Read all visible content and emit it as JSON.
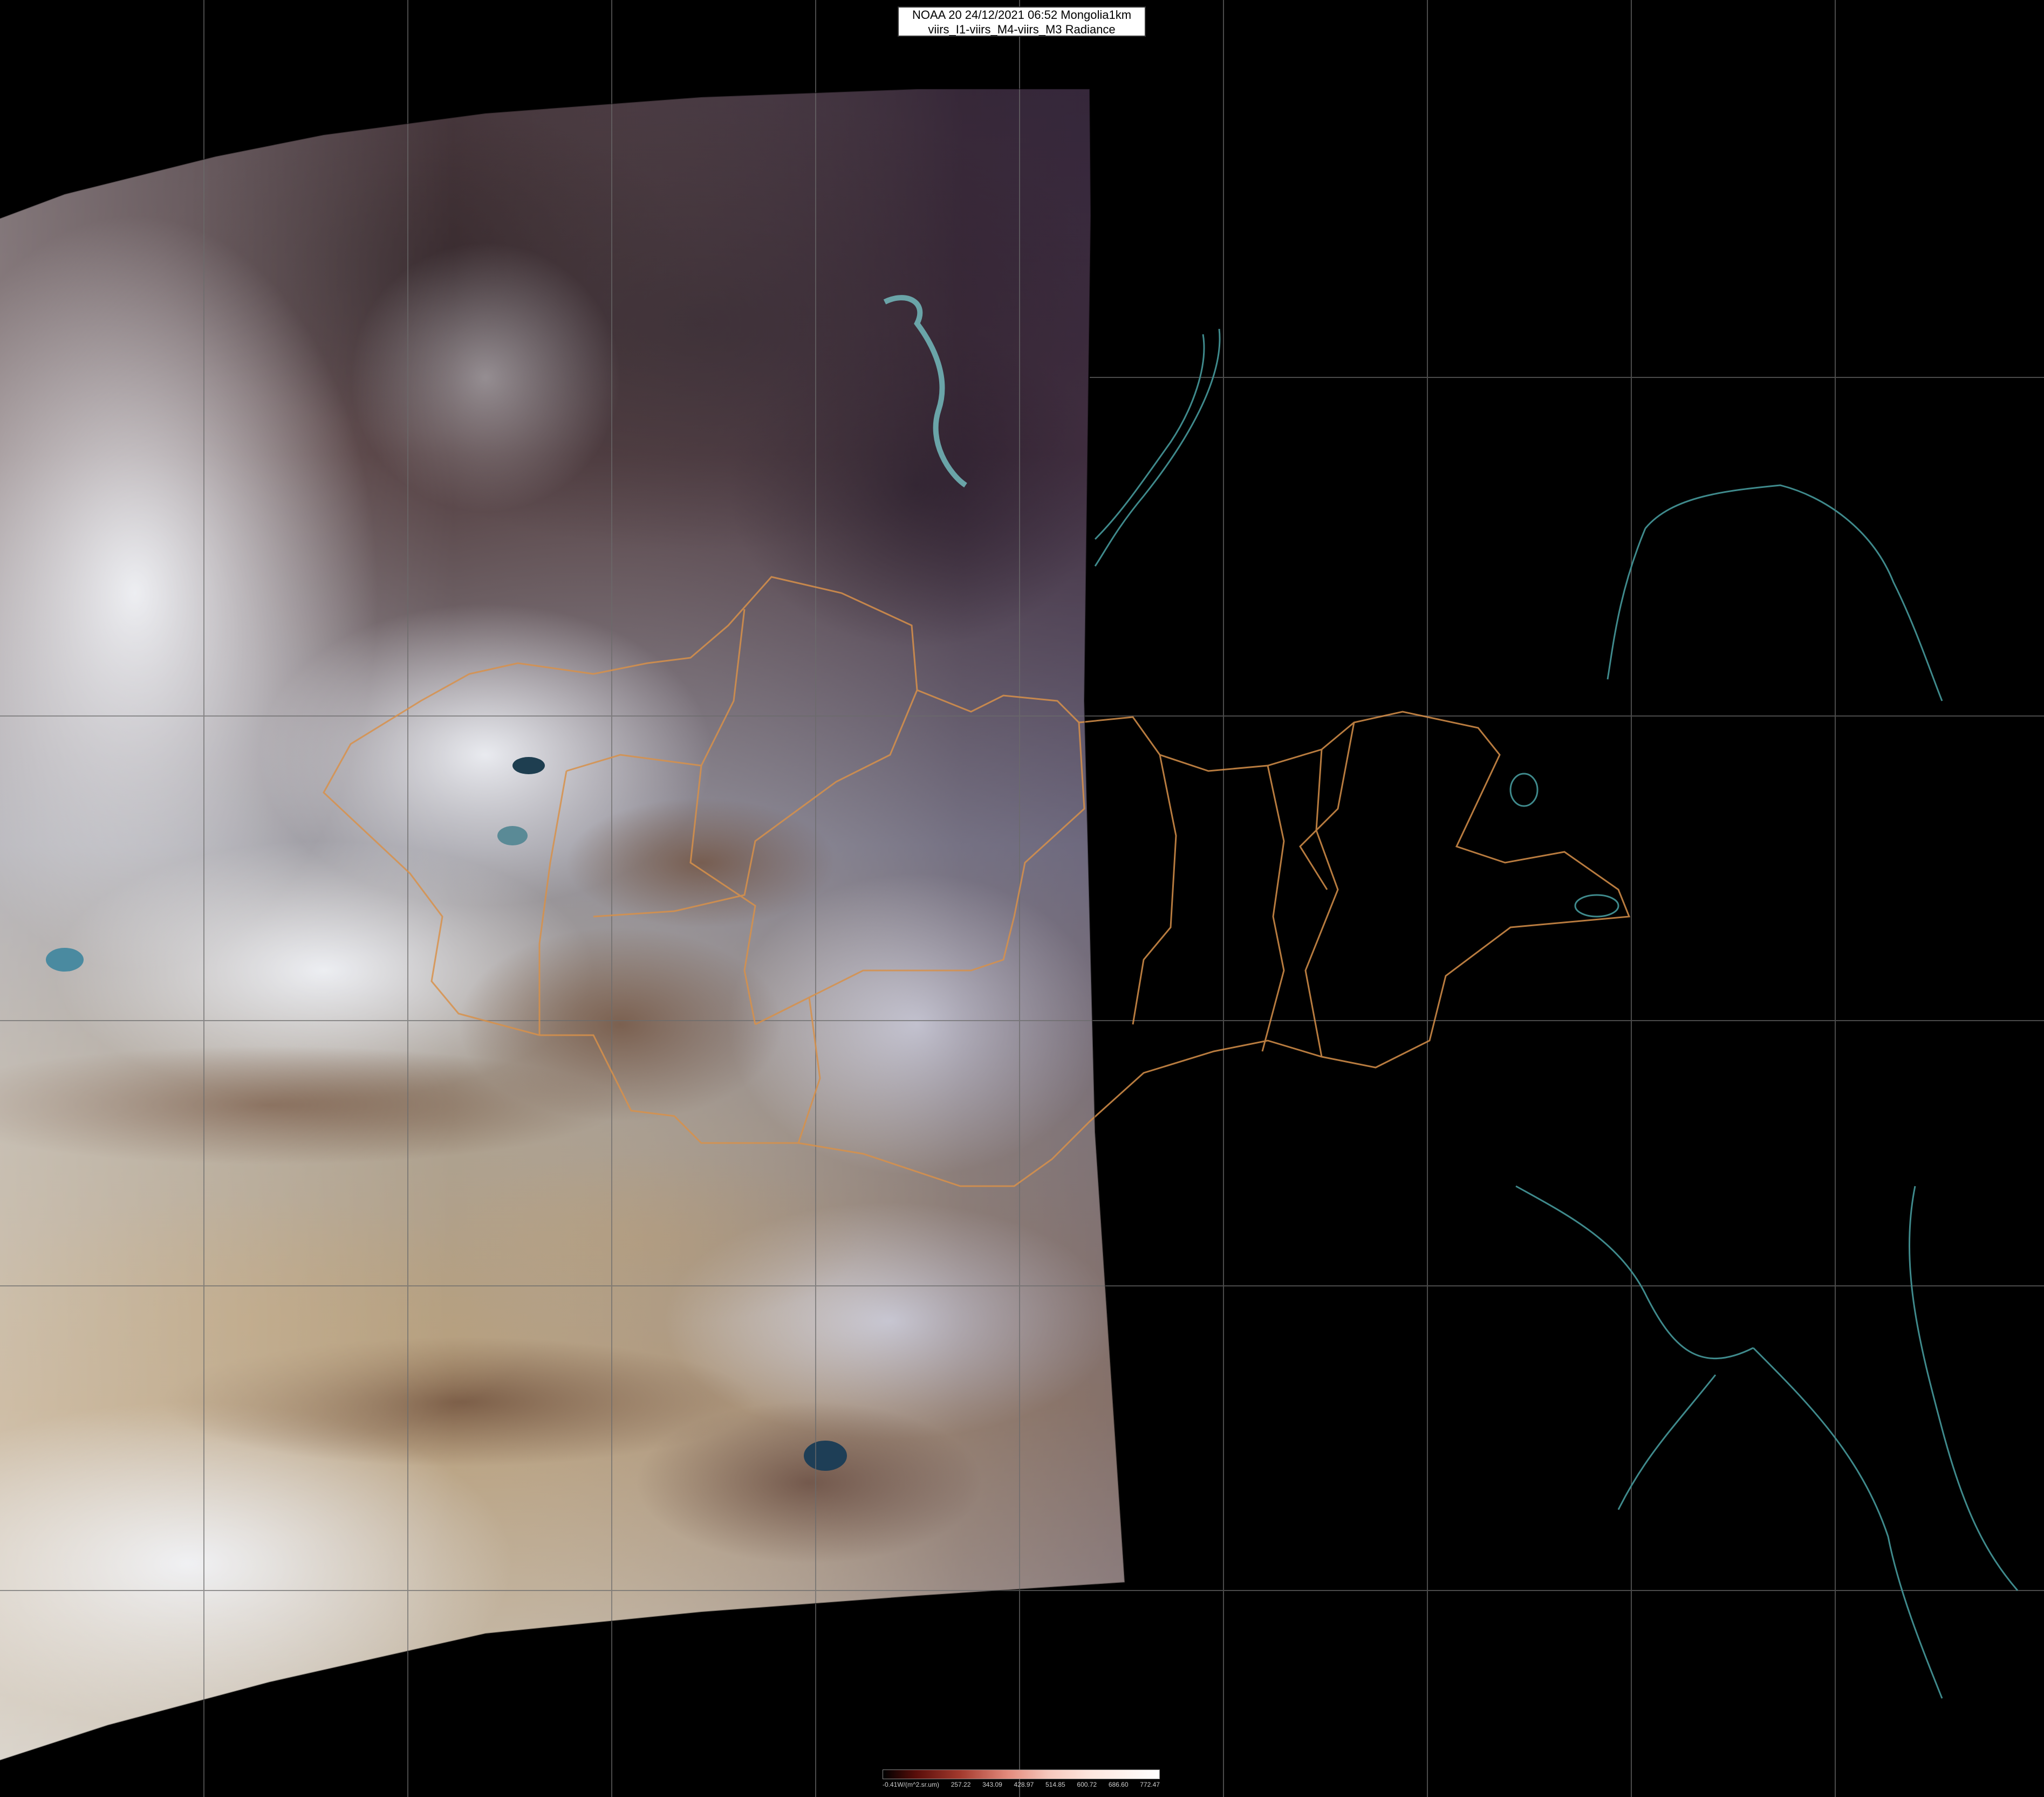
{
  "header": {
    "title_line1": "NOAA 20 24/12/2021 06:52 Mongolia1km",
    "title_line2": "viirs_I1-viirs_M4-viirs_M3 Radiance"
  },
  "colorbar": {
    "tick_labels": [
      "-0.41W/(m^2.sr.um)",
      "257.22",
      "343.09",
      "428.97",
      "514.85",
      "600.72",
      "686.60",
      "772.47"
    ]
  },
  "colors": {
    "background": "#000000",
    "grid": "#6b6b6b",
    "border_lines": "#d8914a",
    "coastline": "#3f8a8c",
    "snow": "#e3e4ea",
    "land_brown": "#7a5a42",
    "desert": "#a48c6c",
    "forest_dark": "#3a2a2e"
  }
}
